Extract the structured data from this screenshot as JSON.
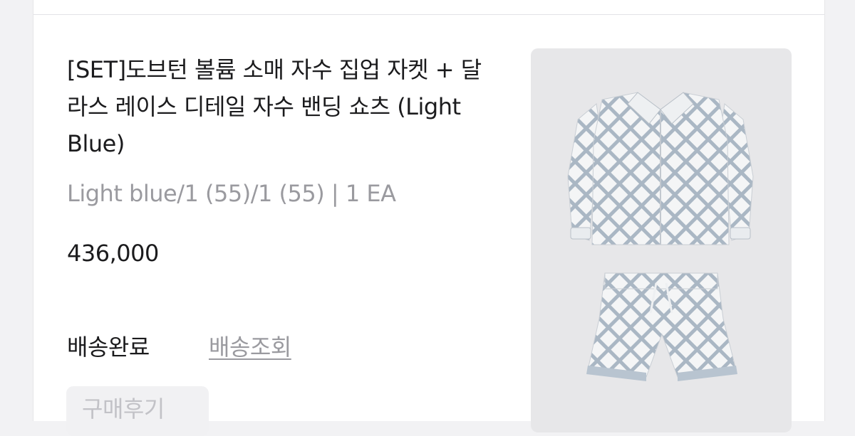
{
  "order_item": {
    "title": "[SET]도브턴 볼륨 소매 자수 집업 자켓 + 달라스 레이스 디테일 자수 밴딩 쇼츠 (Light Blue)",
    "option": "Light blue/1 (55)/1 (55) | 1 EA",
    "price": "436,000",
    "status": "배송완료",
    "tracking_link": "배송조회",
    "review_button": "구매후기",
    "image_alt": "Light Blue embroidered jacket and shorts set"
  },
  "colors": {
    "title_text": "#1b1b1d",
    "muted_text": "#9a9a9f",
    "button_bg": "#f1f1f3",
    "button_text": "#c2c2c7",
    "image_bg": "#e7e7e9",
    "garment_blue": "#aab7c4"
  }
}
